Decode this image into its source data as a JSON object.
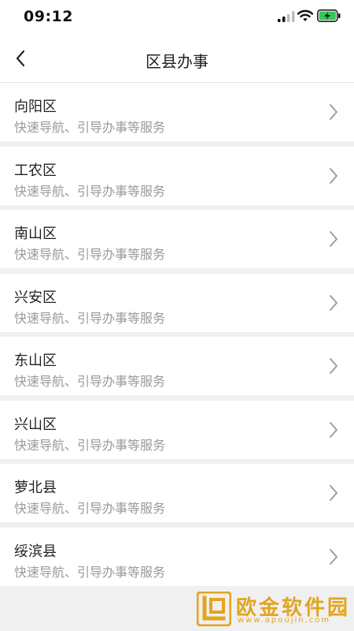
{
  "status_bar": {
    "time": "09:12",
    "icons": [
      "signal-icon",
      "wifi-icon",
      "battery-charging-icon"
    ],
    "battery_color": "#34c759"
  },
  "nav": {
    "title": "区县办事",
    "back_icon": "chevron-left-icon"
  },
  "list": {
    "items": [
      {
        "name": "向阳区",
        "desc": "快速导航、引导办事等服务"
      },
      {
        "name": "工农区",
        "desc": "快速导航、引导办事等服务"
      },
      {
        "name": "南山区",
        "desc": "快速导航、引导办事等服务"
      },
      {
        "name": "兴安区",
        "desc": "快速导航、引导办事等服务"
      },
      {
        "name": "东山区",
        "desc": "快速导航、引导办事等服务"
      },
      {
        "name": "兴山区",
        "desc": "快速导航、引导办事等服务"
      },
      {
        "name": "萝北县",
        "desc": "快速导航、引导办事等服务"
      },
      {
        "name": "绥滨县",
        "desc": "快速导航、引导办事等服务"
      }
    ],
    "chevron_icon": "chevron-right-icon"
  },
  "watermark": {
    "text": "欧金软件园",
    "url": "www.apoujin.com",
    "color": "#e3a51e"
  }
}
